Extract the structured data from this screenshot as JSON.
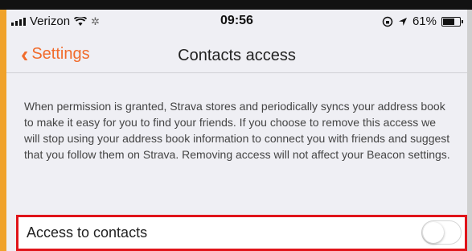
{
  "status_bar": {
    "carrier": "Verizon",
    "time": "09:56",
    "battery_percent": "61%",
    "icons": [
      "signal-icon",
      "wifi-icon",
      "activity-icon",
      "lock-rotation-icon",
      "location-icon",
      "battery-icon"
    ]
  },
  "nav": {
    "back_label": "Settings",
    "title": "Contacts access"
  },
  "description": "When permission is granted, Strava stores and periodically syncs your address book to make it easy for you to find your friends. If you choose to remove this access we will stop using your address book information to connect you with friends and suggest that you follow them on Strava. Removing access will not affect your Beacon settings.",
  "contacts_row": {
    "label": "Access to contacts",
    "toggle_on": false
  },
  "colors": {
    "accent": "#f16b2b",
    "highlight_border": "#e0141a",
    "frame_left": "#f0a22a",
    "background": "#efeff4"
  }
}
